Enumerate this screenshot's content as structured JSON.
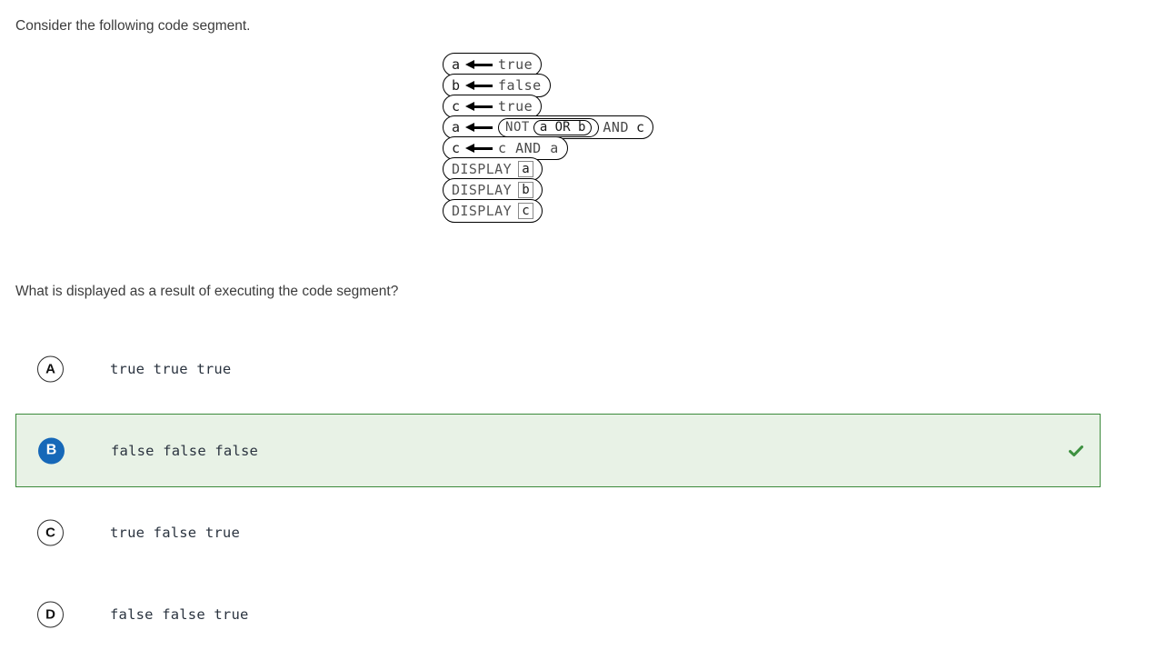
{
  "prompt": {
    "intro": "Consider the following code segment.",
    "question": "What is displayed as a result of executing the code segment?"
  },
  "code_segment": {
    "lines": [
      {
        "type": "assign",
        "target": "a",
        "value": "true"
      },
      {
        "type": "assign",
        "target": "b",
        "value": "false"
      },
      {
        "type": "assign",
        "target": "c",
        "value": "true"
      },
      {
        "type": "assign_expr",
        "target": "a",
        "not_kw": "NOT",
        "inner": "a  OR  b",
        "and_kw": "AND",
        "operand": "c"
      },
      {
        "type": "assign_plain",
        "target": "c",
        "value": "c  AND  a"
      },
      {
        "type": "display",
        "keyword": "DISPLAY",
        "variable": "a"
      },
      {
        "type": "display",
        "keyword": "DISPLAY",
        "variable": "b"
      },
      {
        "type": "display",
        "keyword": "DISPLAY",
        "variable": "c"
      }
    ]
  },
  "choices": [
    {
      "letter": "A",
      "text": "true true true",
      "selected": false
    },
    {
      "letter": "B",
      "text": "false false false",
      "selected": true
    },
    {
      "letter": "C",
      "text": "true false true",
      "selected": false
    },
    {
      "letter": "D",
      "text": "false false true",
      "selected": false
    }
  ],
  "feedback": {
    "icon": "check-icon",
    "color": "#3d9140"
  },
  "colors": {
    "selected_bg": "#e8f2e6",
    "selected_border": "#3b8a3b",
    "badge_blue": "#1668b8"
  }
}
